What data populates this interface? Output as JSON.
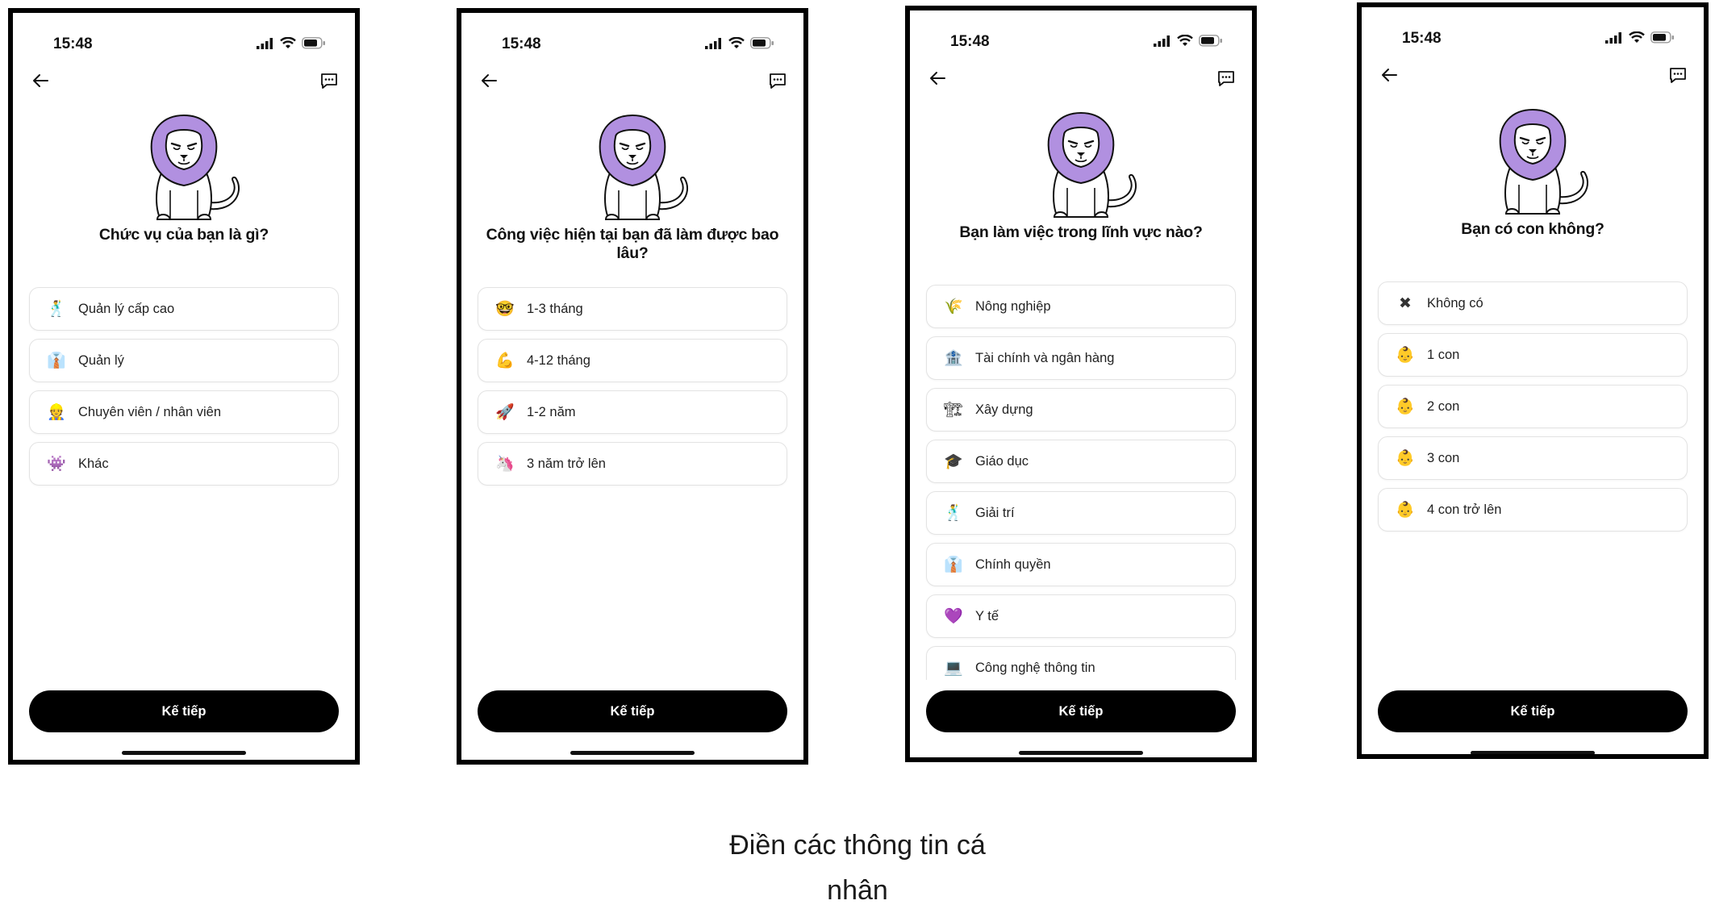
{
  "status_time": "15:48",
  "next_label": "Kế tiếp",
  "caption": {
    "line1": "Điền các thông tin cá",
    "line2": "nhân"
  },
  "screens": [
    {
      "question": "Chức vụ của bạn là gì?",
      "options": [
        {
          "icon": "🕺",
          "icon_name": "dancer-icon",
          "label": "Quản lý cấp cao"
        },
        {
          "icon": "👔",
          "icon_name": "necktie-shirt-icon",
          "label": "Quản lý"
        },
        {
          "icon": "👷",
          "icon_name": "worker-icon",
          "label": "Chuyên viên / nhân viên"
        },
        {
          "icon": "👾",
          "icon_name": "alien-monster-icon",
          "label": "Khác"
        }
      ]
    },
    {
      "question": "Công việc hiện tại bạn đã làm được bao lâu?",
      "options": [
        {
          "icon": "🤓",
          "icon_name": "nerd-face-icon",
          "label": "1-3 tháng"
        },
        {
          "icon": "💪",
          "icon_name": "flexed-biceps-icon",
          "label": "4-12 tháng"
        },
        {
          "icon": "🚀",
          "icon_name": "rocket-icon",
          "label": "1-2 năm"
        },
        {
          "icon": "🦄",
          "icon_name": "unicorn-icon",
          "label": "3 năm trở lên"
        }
      ]
    },
    {
      "question": "Bạn làm việc trong lĩnh vực nào?",
      "options": [
        {
          "icon": "🌾",
          "icon_name": "rice-icon",
          "label": "Nông nghiệp"
        },
        {
          "icon": "🏦",
          "icon_name": "bank-icon",
          "label": "Tài chính và ngân hàng"
        },
        {
          "icon": "🏗",
          "icon_name": "construction-icon",
          "label": "Xây dựng"
        },
        {
          "icon": "🎓",
          "icon_name": "graduation-cap-icon",
          "label": "Giáo dục"
        },
        {
          "icon": "🕺",
          "icon_name": "dancer-icon",
          "label": "Giải trí"
        },
        {
          "icon": "👔",
          "icon_name": "necktie-shirt-icon",
          "label": "Chính quyền"
        },
        {
          "icon": "💜",
          "icon_name": "purple-heart-icon",
          "label": "Y tế"
        },
        {
          "icon": "💻",
          "icon_name": "laptop-icon",
          "label": "Công nghệ thông tin"
        }
      ]
    },
    {
      "question": "Bạn có con không?",
      "options": [
        {
          "icon": "✖",
          "icon_name": "cross-icon",
          "label": "Không có"
        },
        {
          "icon": "👶",
          "icon_name": "baby-icon",
          "label": "1 con"
        },
        {
          "icon": "👶",
          "icon_name": "baby-icon",
          "label": "2 con"
        },
        {
          "icon": "👶",
          "icon_name": "baby-icon",
          "label": "3 con"
        },
        {
          "icon": "👶",
          "icon_name": "baby-icon",
          "label": "4 con trở lên"
        }
      ]
    }
  ],
  "colors": {
    "mane": "#b190e0",
    "mane_dark": "#8f6cc8",
    "button": "#000000",
    "option_border": "#e3e3e3"
  }
}
